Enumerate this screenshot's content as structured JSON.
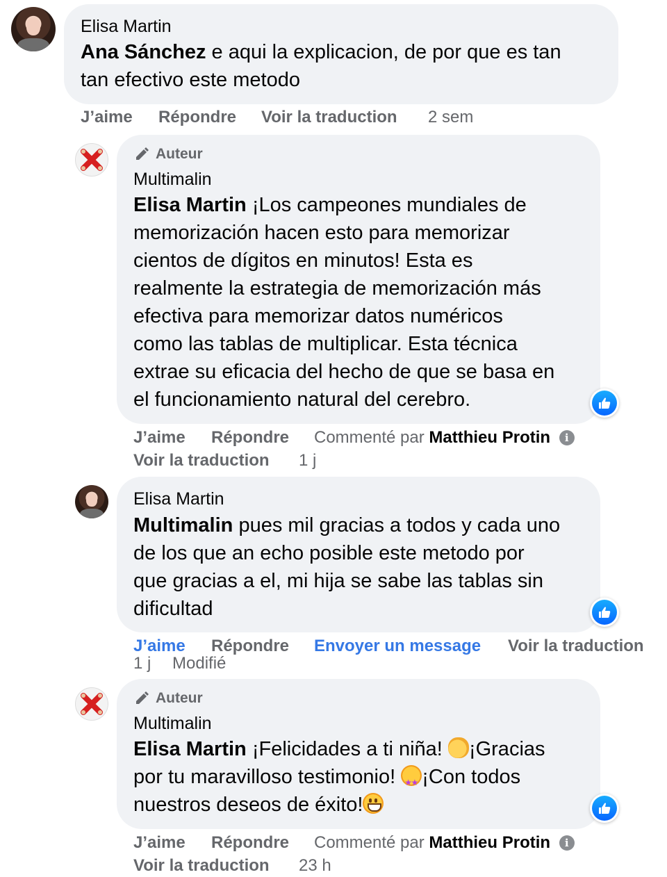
{
  "comments": [
    {
      "name": "Elisa Martin",
      "mention": "Ana Sánchez",
      "text_line1": " e aqui la explicacion, de por que es tan",
      "text_line2": "tan efectivo este metodo",
      "actions": {
        "like": "J’aime",
        "reply": "Répondre",
        "translate": "Voir la traduction",
        "time": "2 sem"
      }
    },
    {
      "badge": "Auteur",
      "name": "Multimalin",
      "mention": "Elisa Martin",
      "lines": [
        " ¡Los campeones mundiales de",
        "memorización hacen esto para memorizar",
        "cientos de dígitos en minutos! Esta es",
        "realmente la estrategia de memorización más",
        "efectiva para memorizar datos numéricos",
        "como las tablas de multiplicar. Esta técnica",
        "extrae su eficacia del hecho de que se basa en",
        "el funcionamiento natural del cerebro."
      ],
      "actions": {
        "like": "J’aime",
        "reply": "Répondre",
        "commented_by_prefix": "Commenté par",
        "commented_by": "Matthieu Protin",
        "translate": "Voir la traduction",
        "time": "1 j"
      }
    },
    {
      "name": "Elisa Martin",
      "mention": "Multimalin",
      "lines": [
        " pues mil gracias a todos y cada uno",
        "de los que an echo posible este metodo por",
        "que gracias a el, mi hija se sabe las tablas sin",
        "dificultad"
      ],
      "actions": {
        "like": "J’aime",
        "reply": "Répondre",
        "message": "Envoyer un message",
        "translate": "Voir la traduction",
        "time": "1 j",
        "edited": "Modifié"
      }
    },
    {
      "badge": "Auteur",
      "name": "Multimalin",
      "mention": "Elisa Martin",
      "line1": " ¡Felicidades a ti niña! ",
      "line1b": "¡Gracias",
      "line2": "por tu maravilloso testimonio! ",
      "line2b": "¡Con todos",
      "line3": "nuestros deseos de éxito!",
      "actions": {
        "like": "J’aime",
        "reply": "Répondre",
        "commented_by_prefix": "Commenté par",
        "commented_by": "Matthieu Protin",
        "translate": "Voir la traduction",
        "time": "23 h"
      }
    }
  ],
  "icons": {
    "like_color": "#0866ff",
    "author_badge_icon": "pencil-mic-icon",
    "info_icon": "info-icon"
  }
}
